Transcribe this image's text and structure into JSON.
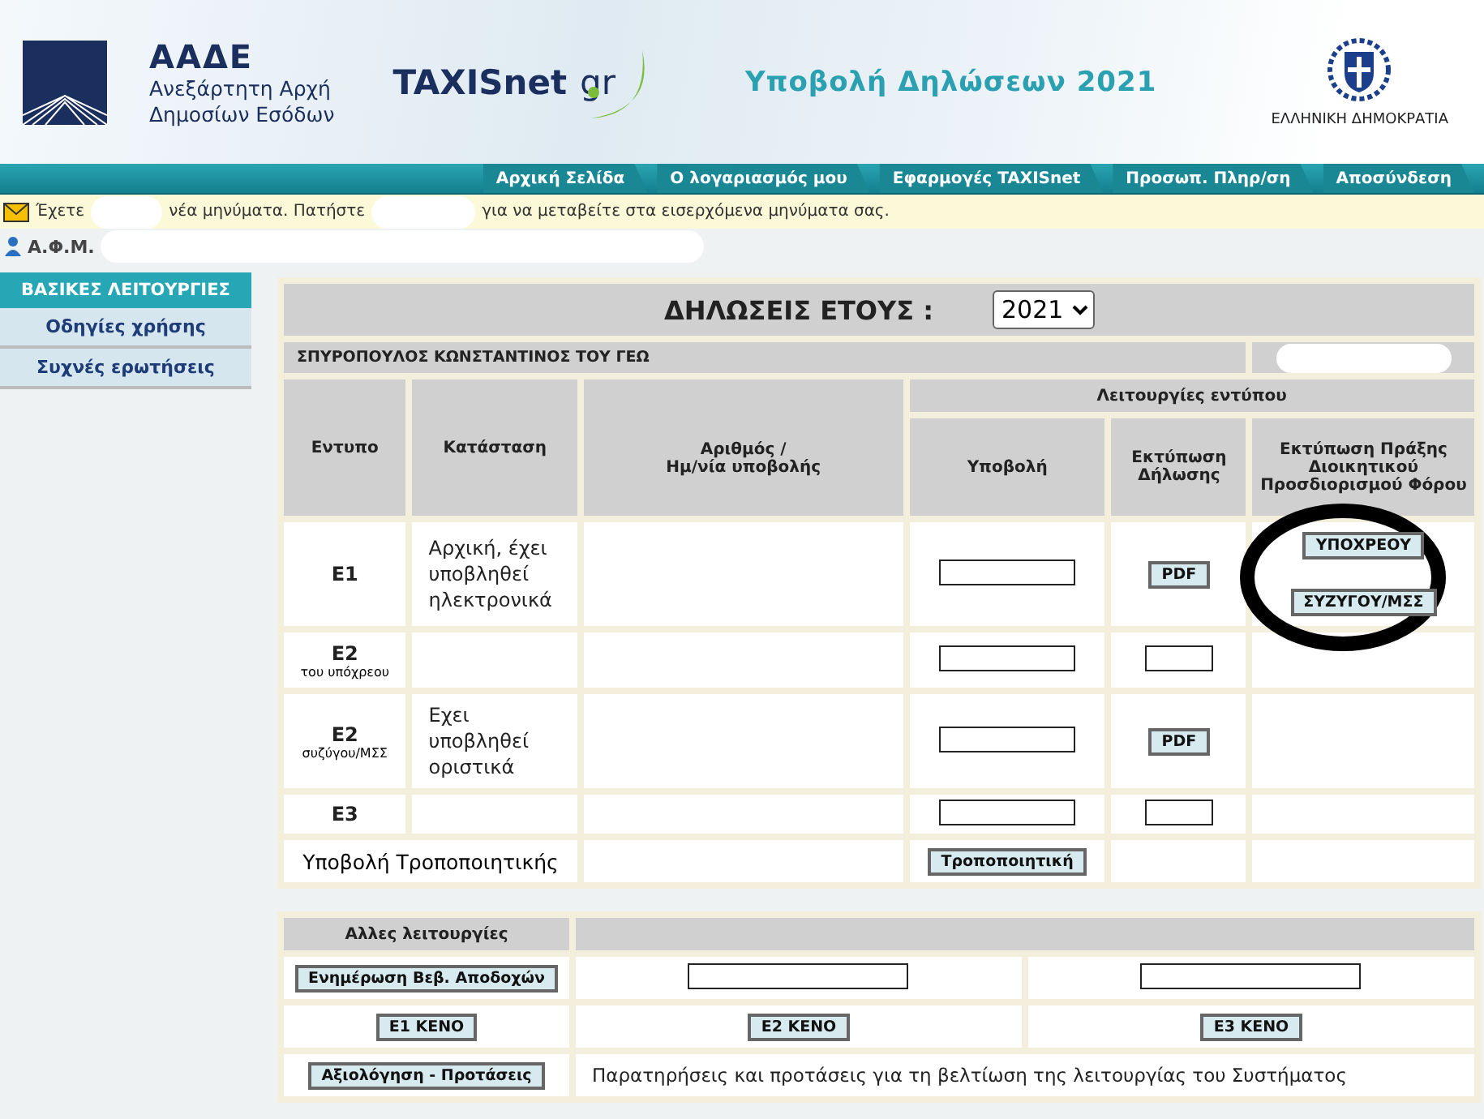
{
  "header": {
    "org": "ΑΑΔΕ",
    "org_lines": [
      "Ανεξάρτητη Αρχή",
      "Δημοσίων Εσόδων"
    ],
    "logo_text": "TAXISnet",
    "logo_suffix": "gr",
    "title": "Υποβολή Δηλώσεων 2021",
    "emblem_caption": "ΕΛΛΗΝΙΚΗ ΔΗΜΟΚΡΑΤΙΑ"
  },
  "nav": [
    "Αρχική Σελίδα",
    "Ο λογαριασμός μου",
    "Εφαρμογές TAXISnet",
    "Προσωπ. Πληρ/ση",
    "Αποσύνδεση"
  ],
  "message": [
    "Έχετε",
    "νέα μηνύματα. Πατήστε",
    "για να μεταβείτε στα εισερχόμενα μηνύματα σας."
  ],
  "afm_label": "Α.Φ.Μ.",
  "sidebar": {
    "title": "ΒΑΣΙΚΕΣ ΛΕΙΤΟΥΡΓΙΕΣ",
    "items": [
      "Οδηγίες χρήσης",
      "Συχνές ερωτήσεις"
    ]
  },
  "declarations": {
    "title": "ΔΗΛΩΣΕΙΣ ΕΤΟΥΣ :",
    "year": "2021",
    "taxpayer": "ΣΠΥΡΟΠΟΥΛΟΣ ΚΩΝΣΤΑΝΤΙΝΟΣ ΤΟΥ ΓΕΩ",
    "columns": [
      "Εντυπο",
      "Κατάσταση",
      "Αριθμός /\nΗμ/νία υποβολής"
    ],
    "group_header": "Λειτουργίες εντύπου",
    "sub_columns": [
      "Υποβολή",
      "Εκτύπωση Δήλωσης",
      "Εκτύπωση Πράξης Διοικητικού Προσδιορισμού Φόρου"
    ],
    "rows": [
      {
        "kind": "form",
        "form": "Ε1",
        "status": "Αρχική, έχει υποβληθεί ηλεκτρονικά",
        "submit": {
          "kind": "blank"
        },
        "pdf": {
          "kind": "labeled",
          "label": "PDF"
        },
        "acts": [
          "ΥΠΟΧΡΕΟΥ",
          "ΣΥΖΥΓΟΥ/ΜΣΣ"
        ]
      },
      {
        "kind": "form",
        "form": "Ε2",
        "form_sub": "του υπόχρεου",
        "submit": {
          "kind": "blank"
        },
        "pdf": {
          "kind": "blank"
        }
      },
      {
        "kind": "form",
        "form": "Ε2",
        "form_sub": "συζύγου/ΜΣΣ",
        "status": "Εχει υποβληθεί οριστικά",
        "submit": {
          "kind": "blank"
        },
        "pdf": {
          "kind": "labeled",
          "label": "PDF"
        }
      },
      {
        "kind": "form",
        "form": "Ε3",
        "submit": {
          "kind": "blank"
        },
        "pdf": {
          "kind": "blank"
        }
      },
      {
        "kind": "amend",
        "label": "Υποβολή Τροποποιητικής",
        "submit": {
          "kind": "labeled",
          "label": "Τροποποιητική"
        }
      }
    ]
  },
  "other": {
    "title": "Αλλες λειτουργίες",
    "rows": [
      {
        "cells": [
          {
            "kind": "button",
            "label": "Ενημέρωση Βεβ. Αποδοχών"
          },
          {
            "kind": "blank"
          },
          {
            "kind": "blank"
          }
        ]
      },
      {
        "cells": [
          {
            "kind": "button",
            "label": "Ε1 ΚΕΝΟ"
          },
          {
            "kind": "button",
            "label": "Ε2 ΚΕΝΟ"
          },
          {
            "kind": "button",
            "label": "Ε3 ΚΕΝΟ"
          }
        ]
      },
      {
        "cells": [
          {
            "kind": "button",
            "label": "Αξιολόγηση - Προτάσεις"
          },
          {
            "kind": "text",
            "colspan": 2,
            "label": "Παρατηρήσεις και προτάσεις για τη βελτίωση της λειτουργίας του Συστήματος"
          }
        ]
      }
    ]
  }
}
